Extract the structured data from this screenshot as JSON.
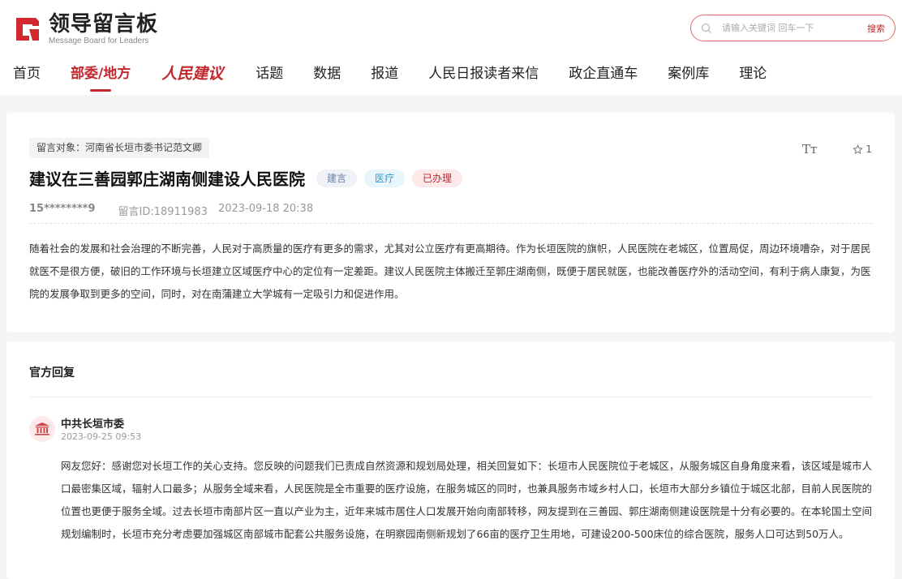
{
  "header": {
    "logo_cn": "领导留言板",
    "logo_en": "Message Board for Leaders",
    "search": {
      "placeholder": "请输入关键词 回车一下",
      "button": "搜索"
    }
  },
  "nav": {
    "items": [
      {
        "label": "首页",
        "active": false
      },
      {
        "label": "部委/地方",
        "active": true
      },
      {
        "label": "人民建议",
        "active": false
      },
      {
        "label": "话题",
        "active": false
      },
      {
        "label": "数据",
        "active": false
      },
      {
        "label": "报道",
        "active": false
      },
      {
        "label": "人民日报读者来信",
        "active": false
      },
      {
        "label": "政企直通车",
        "active": false
      },
      {
        "label": "案例库",
        "active": false
      },
      {
        "label": "理论",
        "active": false
      }
    ]
  },
  "message": {
    "target": "留言对象：河南省长垣市委书记范文卿",
    "font_tool": "Tт",
    "favorite_count": "1",
    "title": "建议在三善园郭庄湖南侧建设人民医院",
    "tags": {
      "type": "建言",
      "domain": "医疗",
      "status": "已办理"
    },
    "author": "15********9",
    "message_id": "留言ID:18911983",
    "time": "2023-09-18 20:38",
    "content": "随着社会的发展和社会治理的不断完善，人民对于高质量的医疗有更多的需求，尤其对公立医疗有更高期待。作为长垣医院的旗帜，人民医院在老城区，位置局促，周边环境嘈杂，对于居民就医不是很方便，破旧的工作环境与长垣建立区域医疗中心的定位有一定差距。建议人民医院主体搬迁至郭庄湖南侧，既便于居民就医，也能改善医疗外的活动空间，有利于病人康复，为医院的发展争取到更多的空间，同时，对在南蒲建立大学城有一定吸引力和促进作用。"
  },
  "reply": {
    "heading": "官方回复",
    "org": "中共长垣市委",
    "time": "2023-09-25 09:53",
    "content": "网友您好：感谢您对长垣工作的关心支持。您反映的问题我们已责成自然资源和规划局处理，相关回复如下：长垣市人民医院位于老城区，从服务城区自身角度来看，该区域是城市人口最密集区域，辐射人口最多；从服务全域来看，人民医院是全市重要的医疗设施，在服务城区的同时，也兼具服务市域乡村人口，长垣市大部分乡镇位于城区北部，目前人民医院的位置也更便于服务全域。过去长垣市南部片区一直以产业为主，近年来城市居住人口发展开始向南部转移，网友提到在三善园、郭庄湖南侧建设医院是十分有必要的。在本轮国土空间规划编制时，长垣市充分考虑要加强城区南部城市配套公共服务设施，在明察园南侧新规划了66亩的医疗卫生用地，可建设200-500床位的综合医院，服务人口可达到50万人。"
  },
  "colors": {
    "accent": "#c0282d"
  }
}
